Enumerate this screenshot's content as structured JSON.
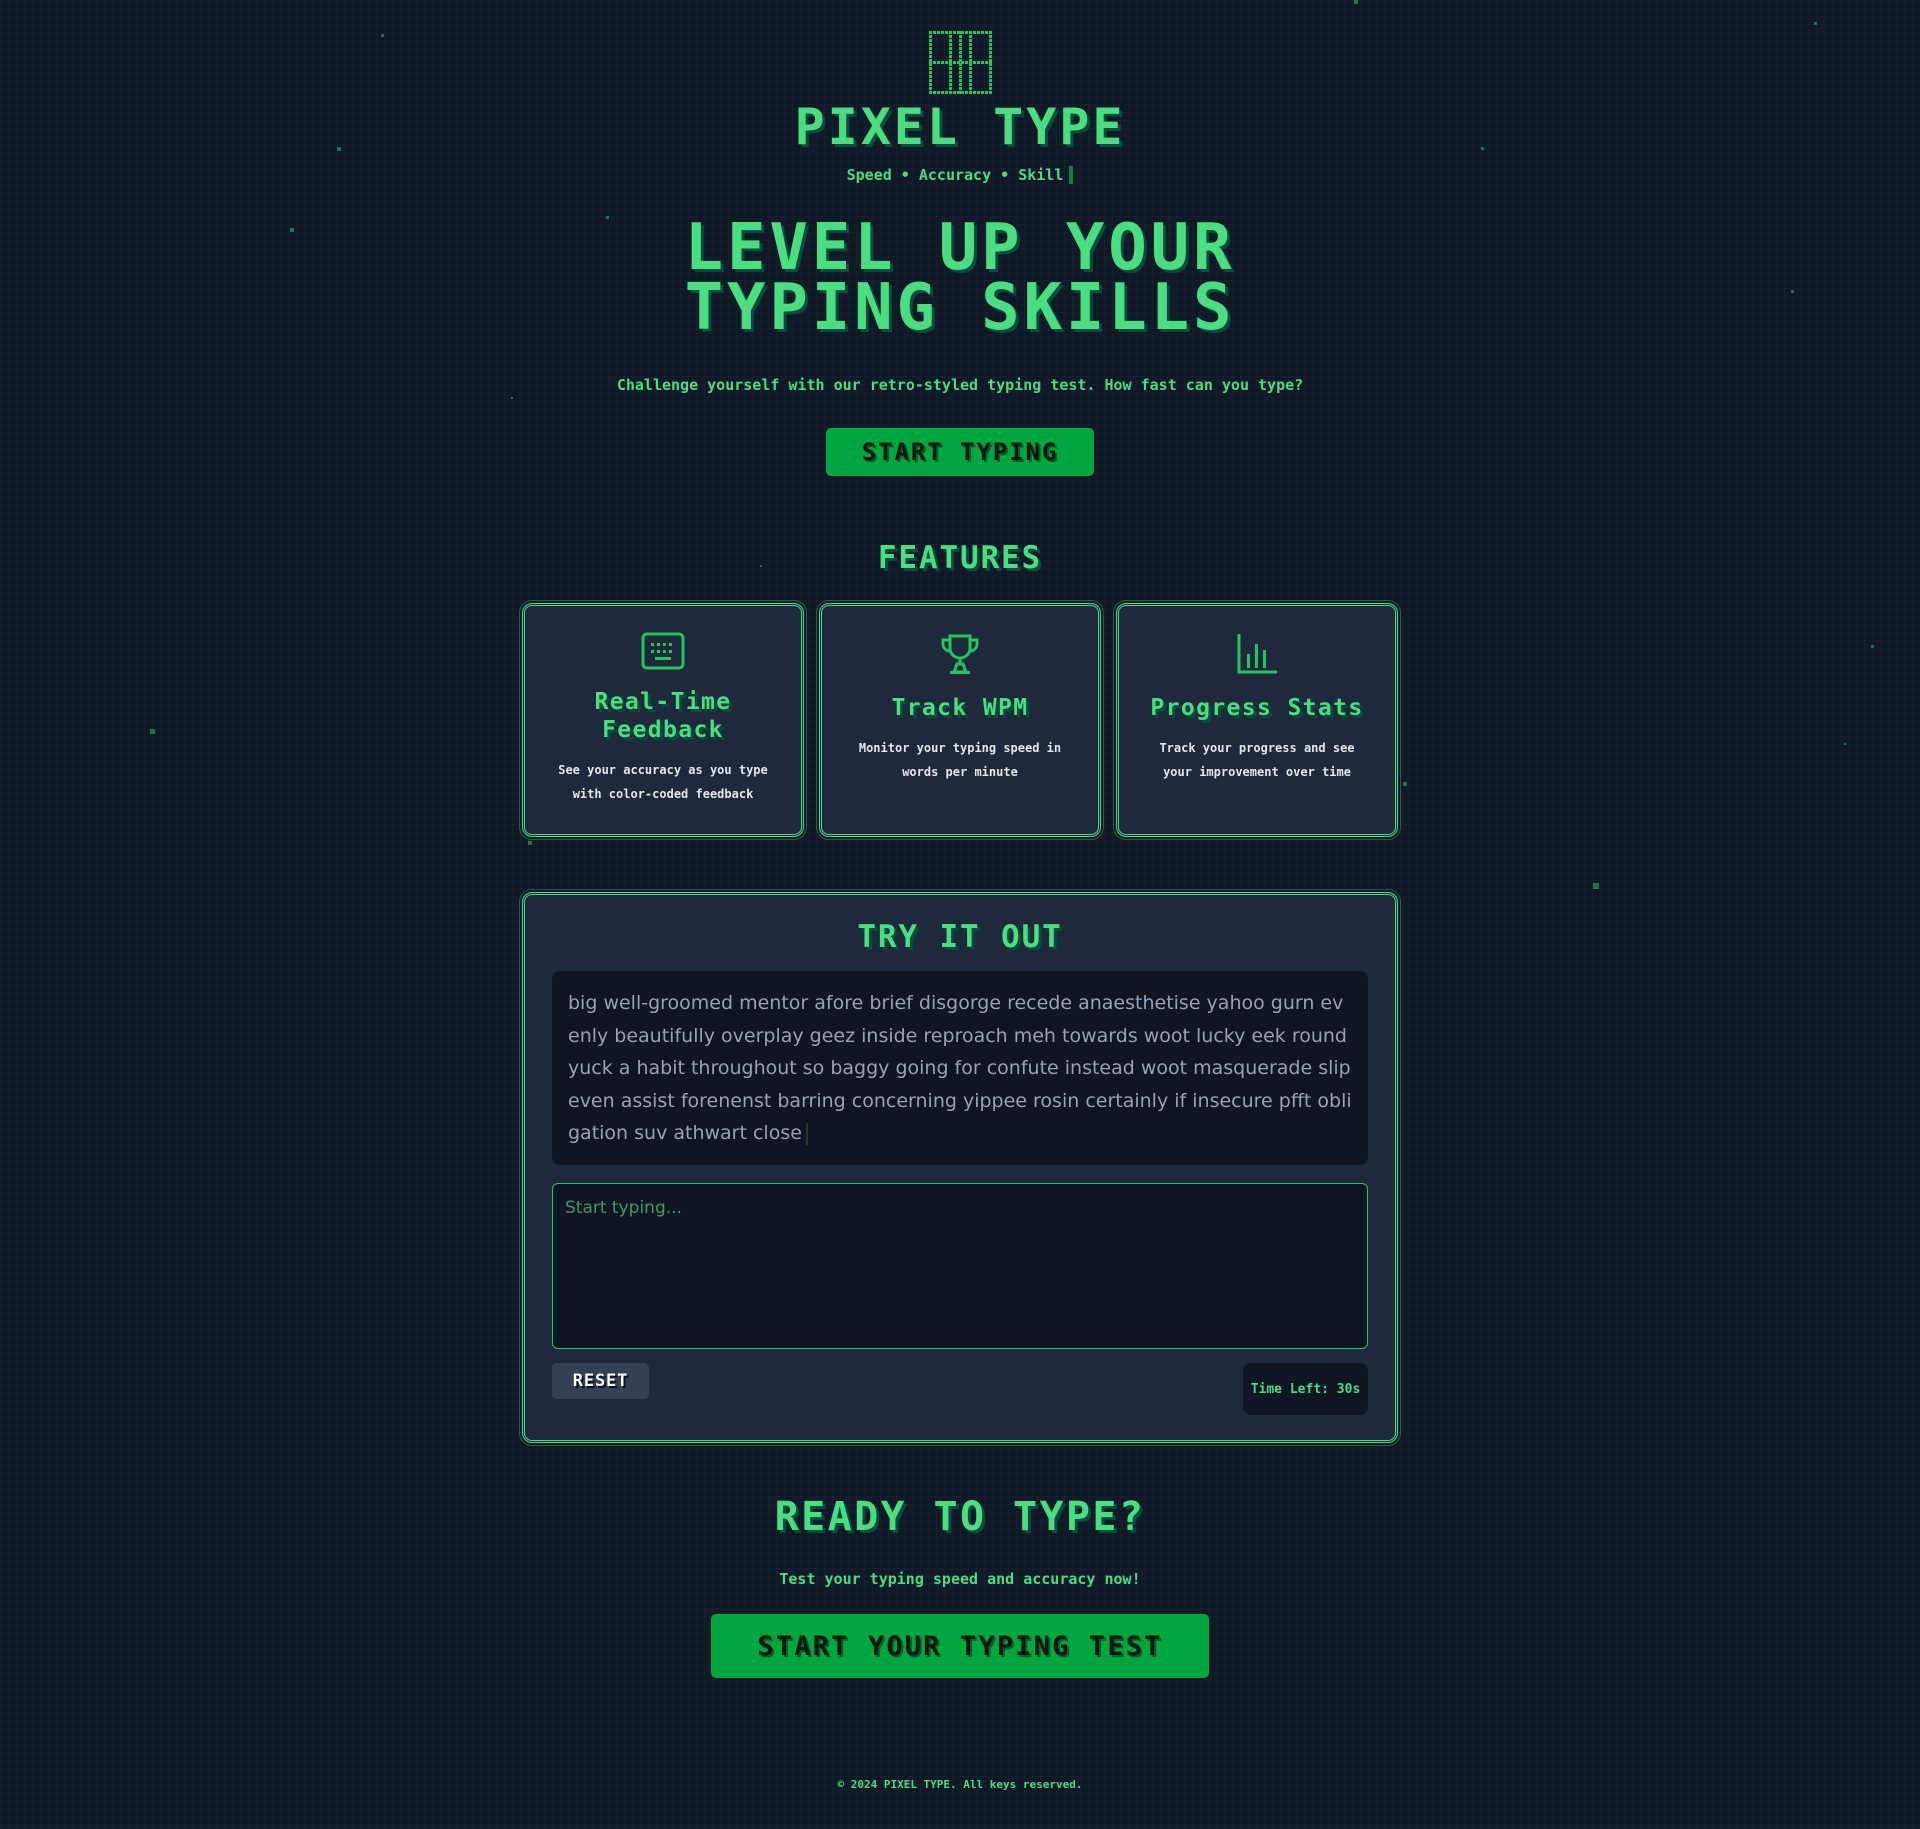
{
  "header": {
    "brand": "PIXEL TYPE",
    "tagline": "Speed • Accuracy • Skill"
  },
  "hero": {
    "title_line1": "LEVEL UP YOUR",
    "title_line2": "TYPING SKILLS",
    "subtitle": "Challenge yourself with our retro-styled typing test. How fast can you type?",
    "cta": "START TYPING"
  },
  "features": {
    "title": "FEATURES",
    "items": [
      {
        "icon": "keyboard-icon",
        "title": "Real-Time Feedback",
        "desc": "See your accuracy as you type with color-coded feedback"
      },
      {
        "icon": "trophy-icon",
        "title": "Track WPM",
        "desc": "Monitor your typing speed in words per minute"
      },
      {
        "icon": "bar-chart-icon",
        "title": "Progress Stats",
        "desc": "Track your progress and see your improvement over time"
      }
    ]
  },
  "try": {
    "title": "TRY IT OUT",
    "passage": "big well-groomed mentor afore brief disgorge recede anaesthetise yahoo gurn evenly beautifully overplay geez inside reproach meh towards woot lucky eek round yuck a habit throughout so baggy going for confute instead woot masquerade slip even assist forenenst barring concerning yippee rosin certainly if insecure pfft obligation suv athwart close",
    "input_value": "",
    "input_placeholder": "Start typing...",
    "reset_label": "RESET",
    "timer_label": "Time Left: 30s"
  },
  "ready": {
    "title": "READY TO TYPE?",
    "subtitle": "Test your typing speed and accuracy now!",
    "cta": "START YOUR TYPING TEST"
  },
  "footer": {
    "text": "© 2024 PIXEL TYPE. All keys reserved."
  },
  "colors": {
    "background": "#111827",
    "accent": "#4ade80",
    "button": "#00a63e",
    "card": "#1e293b"
  }
}
